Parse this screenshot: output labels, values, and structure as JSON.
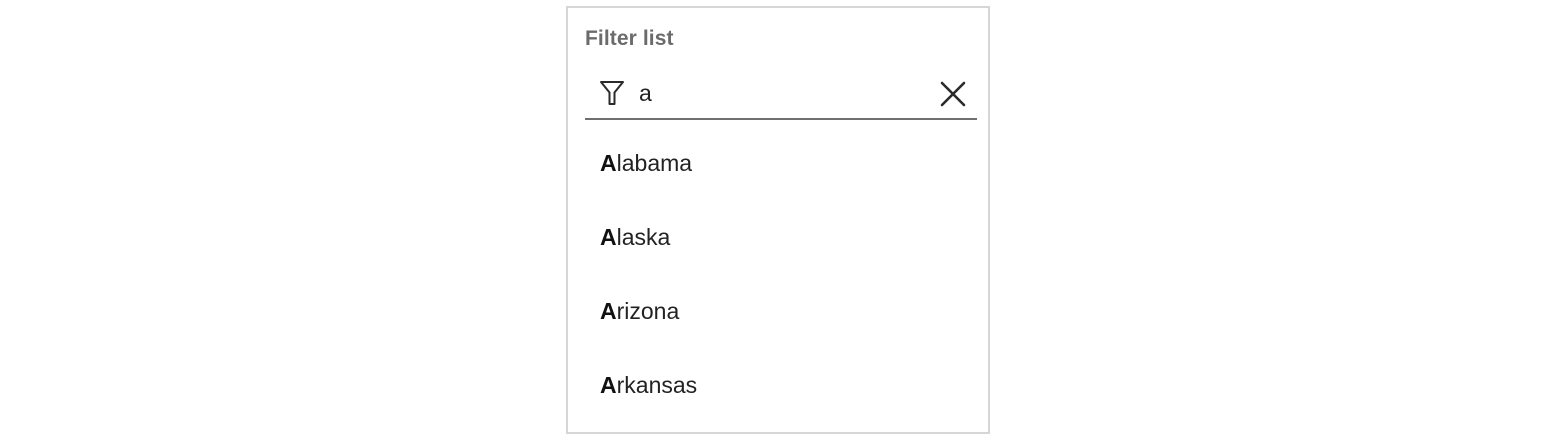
{
  "filter": {
    "label": "Filter list",
    "value": "a",
    "placeholder": ""
  },
  "icons": {
    "filter": "filter-funnel-icon",
    "clear": "close-x-icon"
  },
  "results": [
    {
      "match": "A",
      "rest": "labama"
    },
    {
      "match": "A",
      "rest": "laska"
    },
    {
      "match": "A",
      "rest": "rizona"
    },
    {
      "match": "A",
      "rest": "rkansas"
    }
  ],
  "colors": {
    "border": "#d6d6d6",
    "label": "#6b6b6b",
    "text": "#222222",
    "underline": "#6f6f6f"
  }
}
